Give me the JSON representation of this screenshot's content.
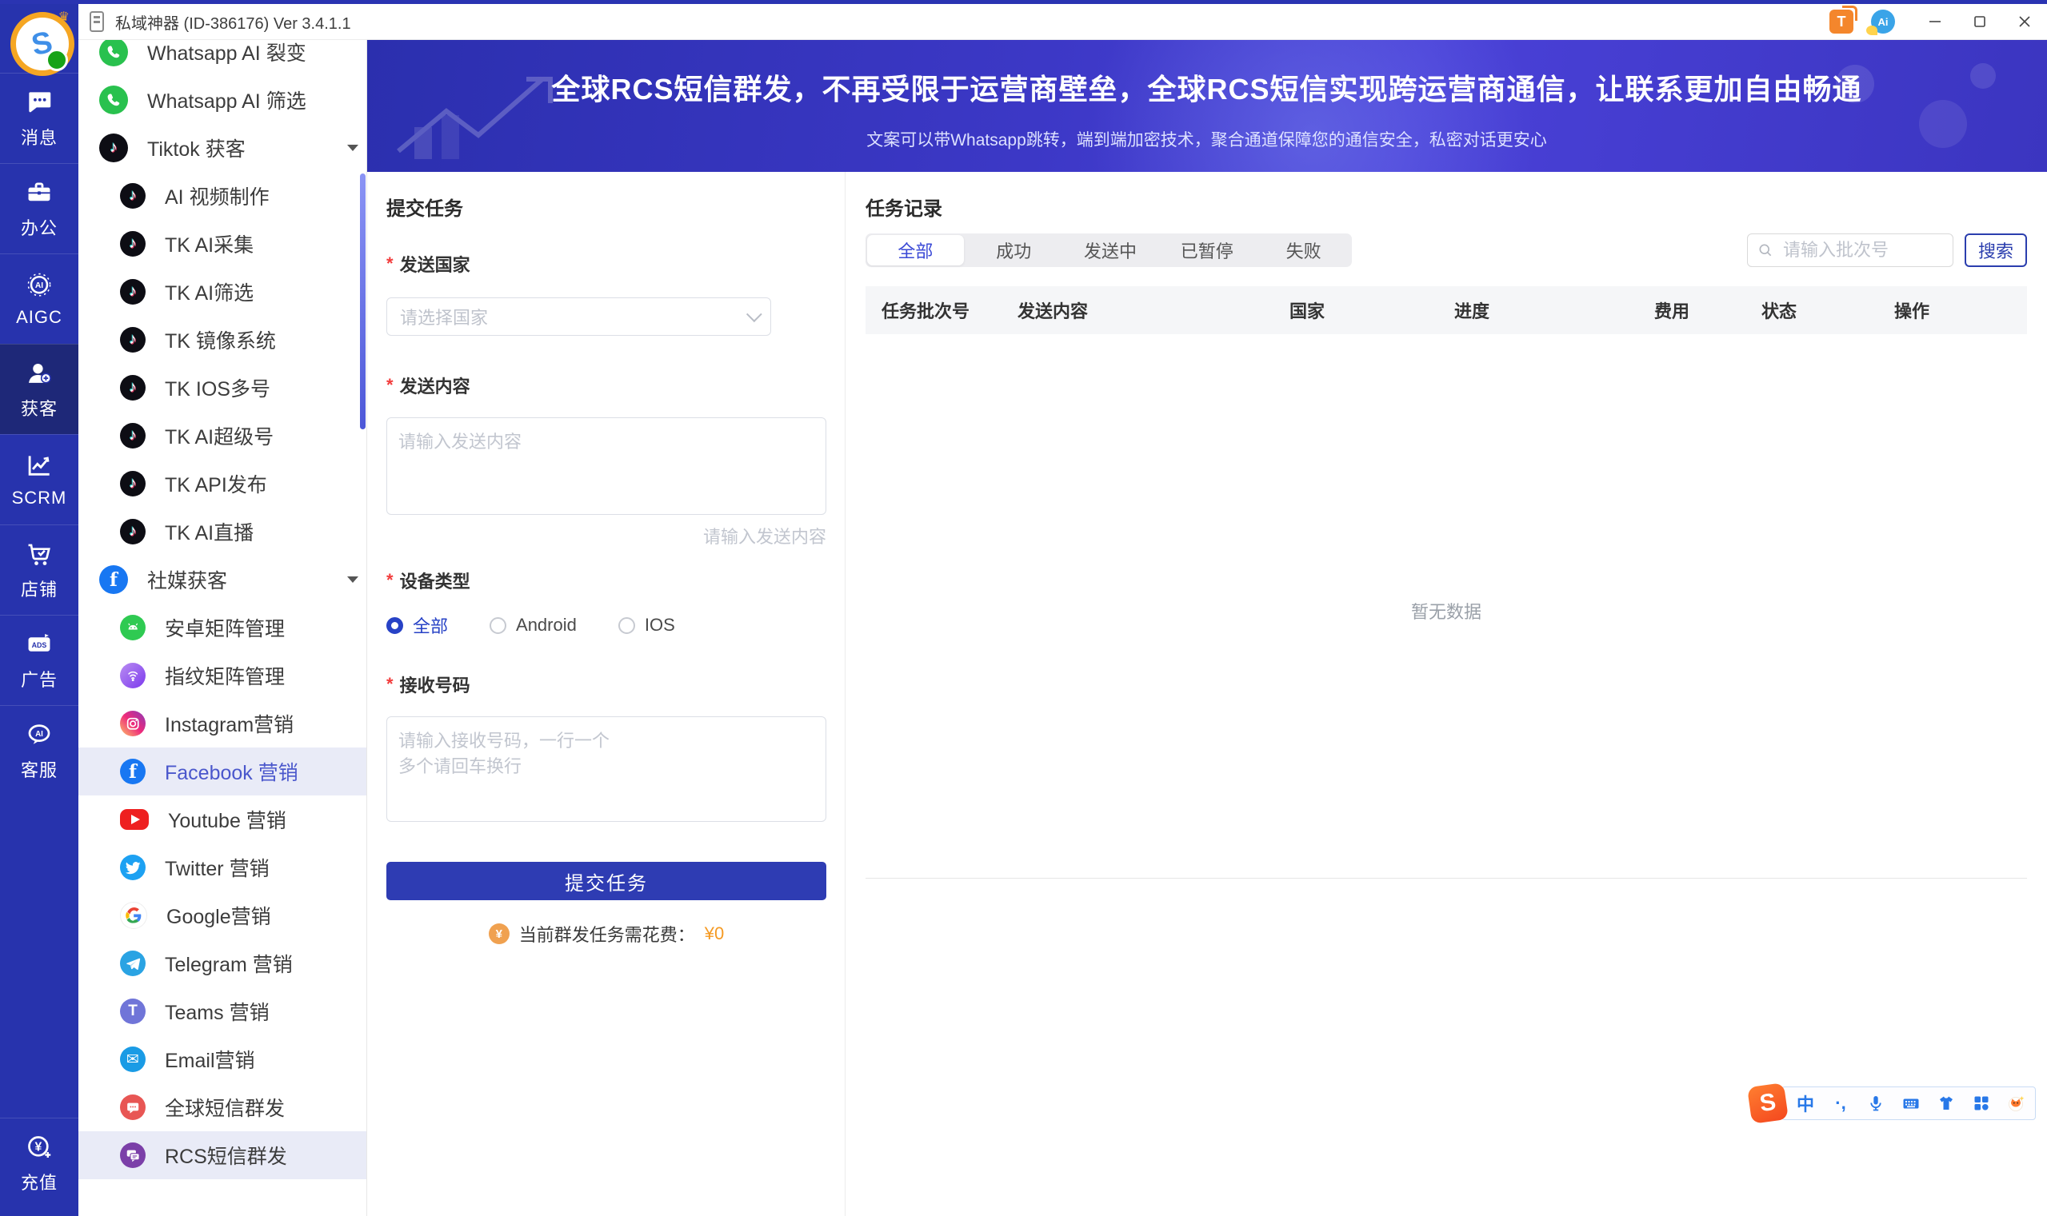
{
  "window": {
    "title": "私域神器 (ID-386176)  Ver 3.4.1.1"
  },
  "icons": {
    "ai_text": "AI",
    "ads_text": "ADS",
    "tray_t_text": "T",
    "tray_ai_text": "Ai",
    "logo_letter": "S",
    "crown": "♛"
  },
  "rail": {
    "items": [
      {
        "label": "消息",
        "icon": "chat-icon"
      },
      {
        "label": "办公",
        "icon": "briefcase-icon"
      },
      {
        "label": "AIGC",
        "icon": "robot-icon"
      },
      {
        "label": "获客",
        "icon": "user-plus-icon",
        "active": true
      },
      {
        "label": "SCRM",
        "icon": "chart-icon"
      },
      {
        "label": "店铺",
        "icon": "cart-icon"
      },
      {
        "label": "广告",
        "icon": "ads-icon"
      },
      {
        "label": "客服",
        "icon": "service-icon"
      }
    ],
    "recharge": {
      "label": "充值",
      "icon": "recharge-icon"
    }
  },
  "sidebar": {
    "items": [
      {
        "label": "Whatsapp AI 裂变",
        "icon": "whatsapp-icon",
        "level": 1
      },
      {
        "label": "Whatsapp AI 筛选",
        "icon": "whatsapp-icon",
        "level": 1
      },
      {
        "label": "Tiktok 获客",
        "icon": "tiktok-icon",
        "level": 1,
        "group": true
      },
      {
        "label": "AI 视频制作",
        "icon": "tiktok-icon",
        "level": 2
      },
      {
        "label": "TK AI采集",
        "icon": "tiktok-icon",
        "level": 2
      },
      {
        "label": "TK AI筛选",
        "icon": "tiktok-icon",
        "level": 2
      },
      {
        "label": "TK 镜像系统",
        "icon": "tiktok-icon",
        "level": 2
      },
      {
        "label": "TK IOS多号",
        "icon": "tiktok-icon",
        "level": 2
      },
      {
        "label": "TK AI超级号",
        "icon": "tiktok-icon",
        "level": 2
      },
      {
        "label": "TK API发布",
        "icon": "tiktok-icon",
        "level": 2
      },
      {
        "label": "TK AI直播",
        "icon": "tiktok-icon",
        "level": 2
      },
      {
        "label": "社媒获客",
        "icon": "facebook-icon",
        "level": 1,
        "group": true
      },
      {
        "label": "安卓矩阵管理",
        "icon": "android-icon",
        "level": 2
      },
      {
        "label": "指纹矩阵管理",
        "icon": "fingerprint-icon",
        "level": 2
      },
      {
        "label": "Instagram营销",
        "icon": "instagram-icon",
        "level": 2
      },
      {
        "label": "Facebook 营销",
        "icon": "facebook-icon",
        "level": 2,
        "highlighted": true
      },
      {
        "label": "Youtube 营销",
        "icon": "youtube-icon",
        "level": 2
      },
      {
        "label": "Twitter 营销",
        "icon": "twitter-icon",
        "level": 2
      },
      {
        "label": "Google营销",
        "icon": "google-icon",
        "level": 2
      },
      {
        "label": "Telegram 营销",
        "icon": "telegram-icon",
        "level": 2
      },
      {
        "label": "Teams 营销",
        "icon": "teams-icon",
        "level": 2
      },
      {
        "label": "Email营销",
        "icon": "email-icon",
        "level": 2
      },
      {
        "label": "全球短信群发",
        "icon": "sms-bubble-icon",
        "level": 2
      },
      {
        "label": "RCS短信群发",
        "icon": "rcs-bubble-icon",
        "level": 2,
        "active": true
      }
    ]
  },
  "banner": {
    "title": "全球RCS短信群发，不再受限于运营商壁垒，全球RCS短信实现跨运营商通信，让联系更加自由畅通",
    "subtitle": "文案可以带Whatsapp跳转，端到端加密技术，聚合通道保障您的通信安全，私密对话更安心"
  },
  "form": {
    "heading": "提交任务",
    "country": {
      "label": "发送国家",
      "placeholder": "请选择国家"
    },
    "content": {
      "label": "发送内容",
      "placeholder": "请输入发送内容",
      "hint": "请输入发送内容"
    },
    "device": {
      "label": "设备类型",
      "options": [
        {
          "label": "全部",
          "selected": true
        },
        {
          "label": "Android",
          "selected": false
        },
        {
          "label": "IOS",
          "selected": false
        }
      ]
    },
    "numbers": {
      "label": "接收号码",
      "placeholder": "请输入接收号码，一行一个\n多个请回车换行"
    },
    "submit_label": "提交任务",
    "fee": {
      "coin": "¥",
      "label": "当前群发任务需花费：",
      "amount": "¥0"
    }
  },
  "tasks": {
    "heading": "任务记录",
    "tabs": [
      {
        "label": "全部",
        "active": true
      },
      {
        "label": "成功",
        "active": false
      },
      {
        "label": "发送中",
        "active": false
      },
      {
        "label": "已暂停",
        "active": false
      },
      {
        "label": "失败",
        "active": false
      }
    ],
    "search": {
      "placeholder": "请输入批次号",
      "button": "搜索"
    },
    "columns": [
      "任务批次号",
      "发送内容",
      "国家",
      "进度",
      "费用",
      "状态",
      "操作"
    ],
    "empty": "暂无数据"
  },
  "ime": {
    "logo": "S",
    "mode": "中",
    "punct": "·,"
  },
  "colors": {
    "rail_bg": "#2733ad",
    "accent": "#2e3cb3",
    "banner_from": "#2b2fae",
    "banner_to": "#4a41d8",
    "highlight_row": "#e9ebf7",
    "active_tab_text": "#3a49d6",
    "orange": "#f59a23",
    "required_red": "#f23c3c"
  }
}
